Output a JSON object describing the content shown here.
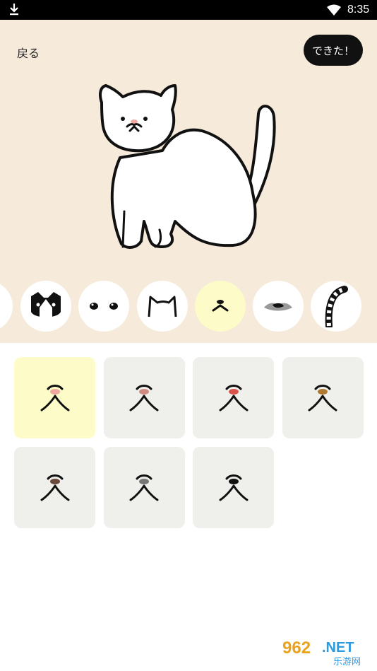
{
  "status_bar": {
    "time": "8:35",
    "icons": [
      "download-icon",
      "wifi-icon",
      "battery-icon"
    ]
  },
  "header": {
    "back_label": "戻る",
    "done_label": "できた！"
  },
  "preview": {
    "subject": "cat-icon",
    "nose_color": "#f2a7a0"
  },
  "parts": {
    "items": [
      "tail-partial-icon",
      "fur-pattern-icon",
      "eyes-icon",
      "ears-icon",
      "mouth-icon",
      "nose-mustache-icon",
      "tail-striped-icon"
    ],
    "selected": "mouth-icon"
  },
  "mouth_options": {
    "nose_colors": [
      "#f2a7a0",
      "#d08b80",
      "#d9544a",
      "#b07a33",
      "#6b4a3e",
      "#777777",
      "#111111"
    ],
    "selected_index": 0
  },
  "colors": {
    "panel_bg": "#f6eada",
    "selected_bg": "#fdfbc8",
    "tile_bg": "#efefeb"
  },
  "watermark": {
    "number": "962",
    "suffix": ".NET",
    "site": "乐游网"
  }
}
